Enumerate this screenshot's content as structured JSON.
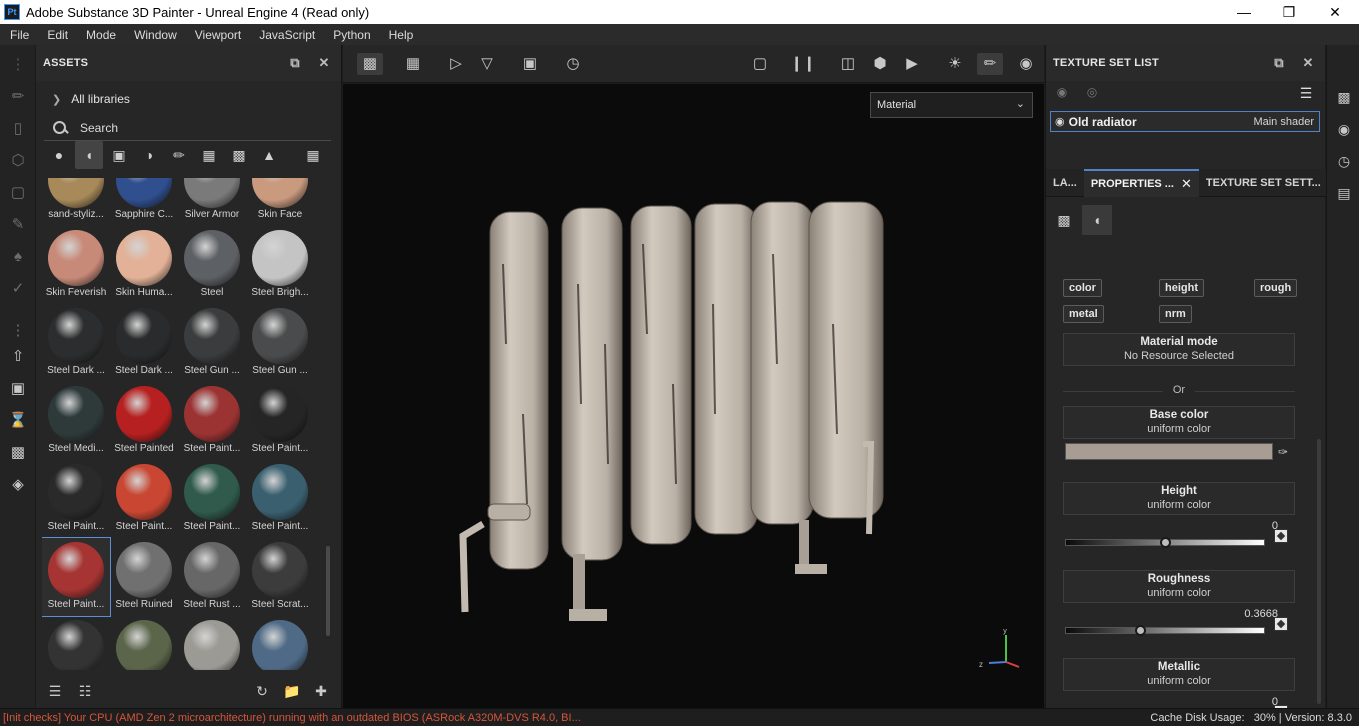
{
  "window": {
    "title": "Adobe Substance 3D Painter - Unreal Engine 4 (Read only)",
    "app_icon": "Pt"
  },
  "menu": [
    "File",
    "Edit",
    "Mode",
    "Window",
    "Viewport",
    "JavaScript",
    "Python",
    "Help"
  ],
  "assets": {
    "title": "ASSETS",
    "library": "All libraries",
    "search_placeholder": "Search",
    "materials": [
      {
        "name": "sand-styliz...",
        "color": "#a88a5a"
      },
      {
        "name": "Sapphire C...",
        "color": "#2f4f8e"
      },
      {
        "name": "Silver Armor",
        "color": "#7a7a7a"
      },
      {
        "name": "Skin Face",
        "color": "#c99a7e"
      },
      {
        "name": "Skin Feverish",
        "color": "#c88a78"
      },
      {
        "name": "Skin Huma...",
        "color": "#e2b197"
      },
      {
        "name": "Steel",
        "color": "#5d6064"
      },
      {
        "name": "Steel Brigh...",
        "color": "#c4c4c4"
      },
      {
        "name": "Steel Dark ...",
        "color": "#2c2d2e"
      },
      {
        "name": "Steel Dark ...",
        "color": "#2a2b2c"
      },
      {
        "name": "Steel Gun ...",
        "color": "#3b3c3d"
      },
      {
        "name": "Steel Gun ...",
        "color": "#4a4b4c"
      },
      {
        "name": "Steel Medi...",
        "color": "#2e3a3a"
      },
      {
        "name": "Steel Painted",
        "color": "#b62020"
      },
      {
        "name": "Steel Paint...",
        "color": "#9c3333"
      },
      {
        "name": "Steel Paint...",
        "color": "#252525"
      },
      {
        "name": "Steel Paint...",
        "color": "#2a2a2a"
      },
      {
        "name": "Steel Paint...",
        "color": "#c84632"
      },
      {
        "name": "Steel Paint...",
        "color": "#2f5a4c"
      },
      {
        "name": "Steel Paint...",
        "color": "#3a6070"
      },
      {
        "name": "Steel Paint...",
        "color": "#a53432"
      },
      {
        "name": "Steel Ruined",
        "color": "#707070"
      },
      {
        "name": "Steel Rust ...",
        "color": "#676767"
      },
      {
        "name": "Steel Scrat...",
        "color": "#3c3c3c"
      },
      {
        "name": "",
        "color": "#333333"
      },
      {
        "name": "",
        "color": "#5b654a"
      },
      {
        "name": "",
        "color": "#9c9a94"
      },
      {
        "name": "",
        "color": "#4f6a86"
      }
    ],
    "selected_index": 20
  },
  "viewport": {
    "mode_label": "Material"
  },
  "texture_set_list": {
    "title": "TEXTURE SET LIST",
    "item_name": "Old radiator",
    "item_shader": "Main shader"
  },
  "tabs": {
    "layers": "LA...",
    "properties": "PROPERTIES ...",
    "texture_set_settings": "TEXTURE SET SETT..."
  },
  "properties": {
    "channels": [
      "color",
      "height",
      "rough",
      "metal",
      "nrm"
    ],
    "material_mode": {
      "title": "Material mode",
      "value": "No Resource Selected"
    },
    "or_label": "Or",
    "base_color": {
      "title": "Base color",
      "sub": "uniform color",
      "swatch": "#a79d93"
    },
    "height": {
      "title": "Height",
      "sub": "uniform color",
      "value": "0",
      "fraction": 0.5
    },
    "roughness": {
      "title": "Roughness",
      "sub": "uniform color",
      "value": "0.3668",
      "fraction": 0.3668
    },
    "metallic": {
      "title": "Metallic",
      "sub": "uniform color",
      "value": "0",
      "fraction": 0
    }
  },
  "status": {
    "warning": "[Init checks] Your CPU (AMD Zen 2 microarchitecture) running with an outdated BIOS (ASRock A320M-DVS R4.0, BI...",
    "cache": "Cache Disk Usage:",
    "cache_value": "30%",
    "version": "Version: 8.3.0"
  }
}
